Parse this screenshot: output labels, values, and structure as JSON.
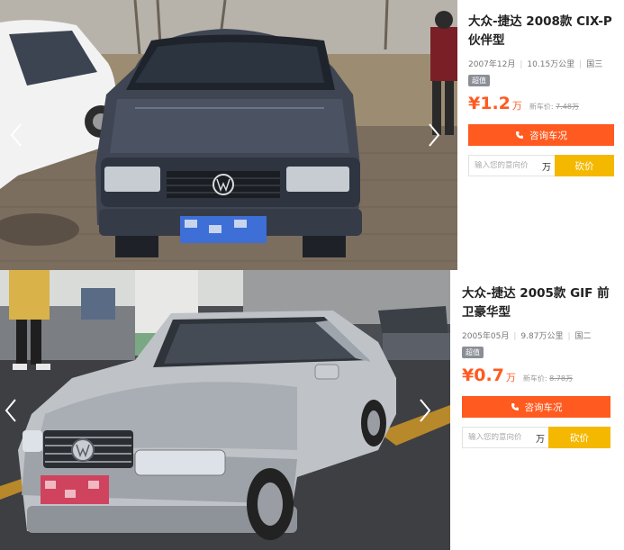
{
  "listings": [
    {
      "title": "大众-捷达 2008款 CIX-P伙伴型",
      "reg_date": "2007年12月",
      "mileage": "10.15万公里",
      "emission": "国三",
      "badge": "超值",
      "price_symbol": "¥",
      "price": "1.2",
      "price_unit": "万",
      "new_price_label": "新车价:",
      "new_price": "7.48万",
      "inquiry_label": "咨询车况",
      "offer_placeholder": "输入您的意向价",
      "offer_unit": "万",
      "bargain_label": "砍价",
      "car_color": "dark-gray"
    },
    {
      "title": "大众-捷达 2005款 GIF 前卫豪华型",
      "reg_date": "2005年05月",
      "mileage": "9.87万公里",
      "emission": "国二",
      "badge": "超值",
      "price_symbol": "¥",
      "price": "0.7",
      "price_unit": "万",
      "new_price_label": "新车价:",
      "new_price": "8.78万",
      "inquiry_label": "咨询车况",
      "offer_placeholder": "输入您的意向价",
      "offer_unit": "万",
      "bargain_label": "砍价",
      "car_color": "silver"
    }
  ],
  "icons": {
    "prev": "chevron-left-icon",
    "next": "chevron-right-icon",
    "inquiry": "phone-icon"
  },
  "colors": {
    "accent": "#ff5a1f",
    "bargain": "#f5b800",
    "badge": "#8a8f96"
  }
}
